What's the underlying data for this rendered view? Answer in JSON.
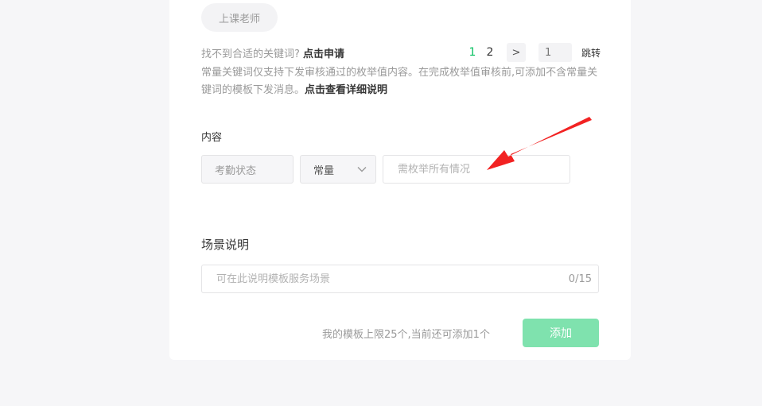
{
  "keyword_chip": {
    "label": "上课老师"
  },
  "hint": {
    "prefix": "找不到合适的关键词?",
    "link": "点击申请"
  },
  "pagination": {
    "pages": [
      "1",
      "2"
    ],
    "active_page": "1",
    "next_icon": "chevron-right-icon",
    "next_glyph": ">",
    "jump_placeholder": "1",
    "jump_label": "跳转"
  },
  "description": {
    "text": "常量关键词仅支持下发审核通过的枚举值内容。在完成枚举值审核前,可添加不含常量关键词的模板下发消息。",
    "link": "点击查看详细说明"
  },
  "content_section": {
    "label": "内容",
    "keyword_name": "考勤状态",
    "keyword_type": "常量",
    "dropdown_icon": "chevron-down-icon",
    "value_placeholder": "需枚举所有情况"
  },
  "scene_section": {
    "label": "场景说明",
    "placeholder": "可在此说明模板服务场景",
    "counter": "0/15"
  },
  "footer": {
    "limit_text": "我的模板上限25个,当前还可添加1个",
    "add_label": "添加"
  },
  "colors": {
    "accent_green": "#07c160",
    "add_button_disabled": "#7fe2ae",
    "link_blue": "#576b95",
    "annotation_arrow": "#f22222"
  }
}
